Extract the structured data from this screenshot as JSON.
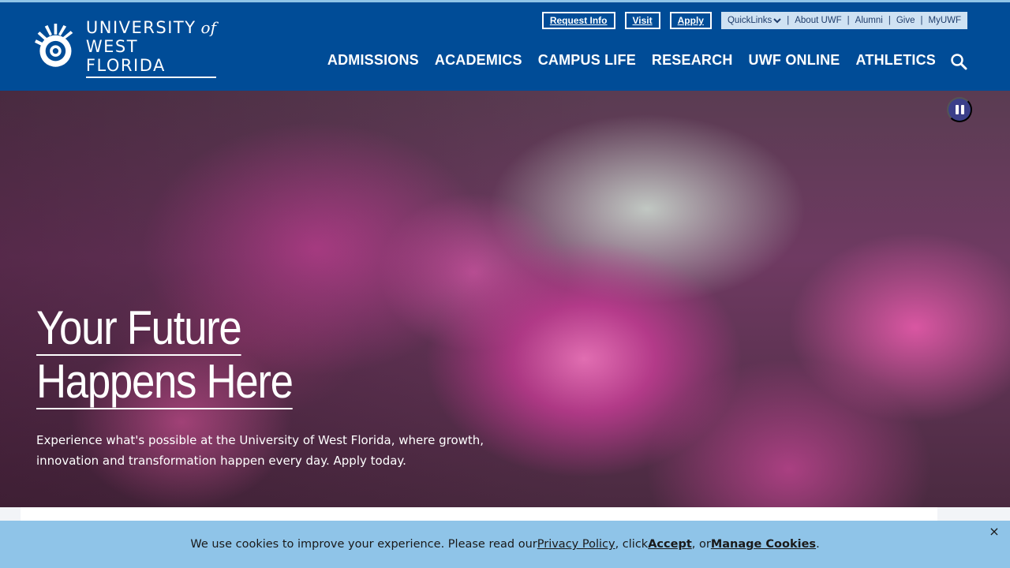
{
  "colors": {
    "brand_blue": "#004c97",
    "accent_light_blue": "#8fc4e8",
    "quicklinks_bg": "#cfe2f3",
    "pause_button": "#3b3f8a"
  },
  "logo": {
    "line1": "UNIVERSITY",
    "of": "of",
    "line2": "WEST FLORIDA",
    "icon": "nautilus-shell-icon"
  },
  "utility": {
    "buttons": [
      "Request Info",
      "Visit",
      "Apply"
    ],
    "quicklinks_label": "QuickLinks",
    "links": [
      "About UWF",
      "Alumni",
      "Give",
      "MyUWF"
    ],
    "separator": "|"
  },
  "nav": {
    "items": [
      "ADMISSIONS",
      "ACADEMICS",
      "CAMPUS LIFE",
      "RESEARCH",
      "UWF ONLINE",
      "ATHLETICS"
    ]
  },
  "hero": {
    "title_line1": "Your Future",
    "title_line2": "Happens Here",
    "subtitle": "Experience what's possible at the University of West Florida, where growth, innovation and transformation happen every day. Apply today."
  },
  "cookie": {
    "text_before": "We use cookies to improve your experience. Please read our ",
    "privacy_link": "Privacy Policy",
    "text_mid1": ", click ",
    "accept_link": "Accept",
    "text_mid2": ", or ",
    "manage_link": "Manage Cookies",
    "text_end": ".",
    "close_glyph": "×"
  }
}
